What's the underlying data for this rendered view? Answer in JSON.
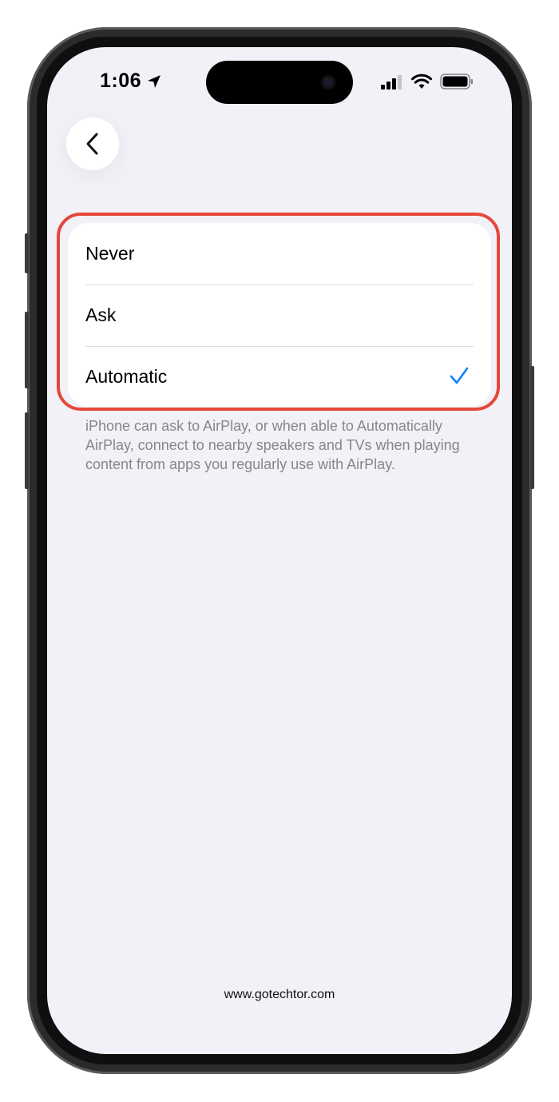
{
  "status_bar": {
    "time": "1:06",
    "icons": [
      "location-arrow-icon",
      "cellular-signal-icon",
      "wifi-icon",
      "battery-icon"
    ]
  },
  "nav": {
    "back_icon": "chevron-left-icon"
  },
  "options": [
    {
      "label": "Never",
      "selected": false
    },
    {
      "label": "Ask",
      "selected": false
    },
    {
      "label": "Automatic",
      "selected": true
    }
  ],
  "footnote": "iPhone can ask to AirPlay, or when able to Automatically AirPlay, connect to nearby speakers and TVs when playing content from apps you regularly use with AirPlay.",
  "watermark": "www.gotechtor.com",
  "colors": {
    "accent": "#0a84ff",
    "highlight": "#e5473b",
    "screen_background": "#f2f1f7",
    "footnote_text": "#86868b"
  }
}
